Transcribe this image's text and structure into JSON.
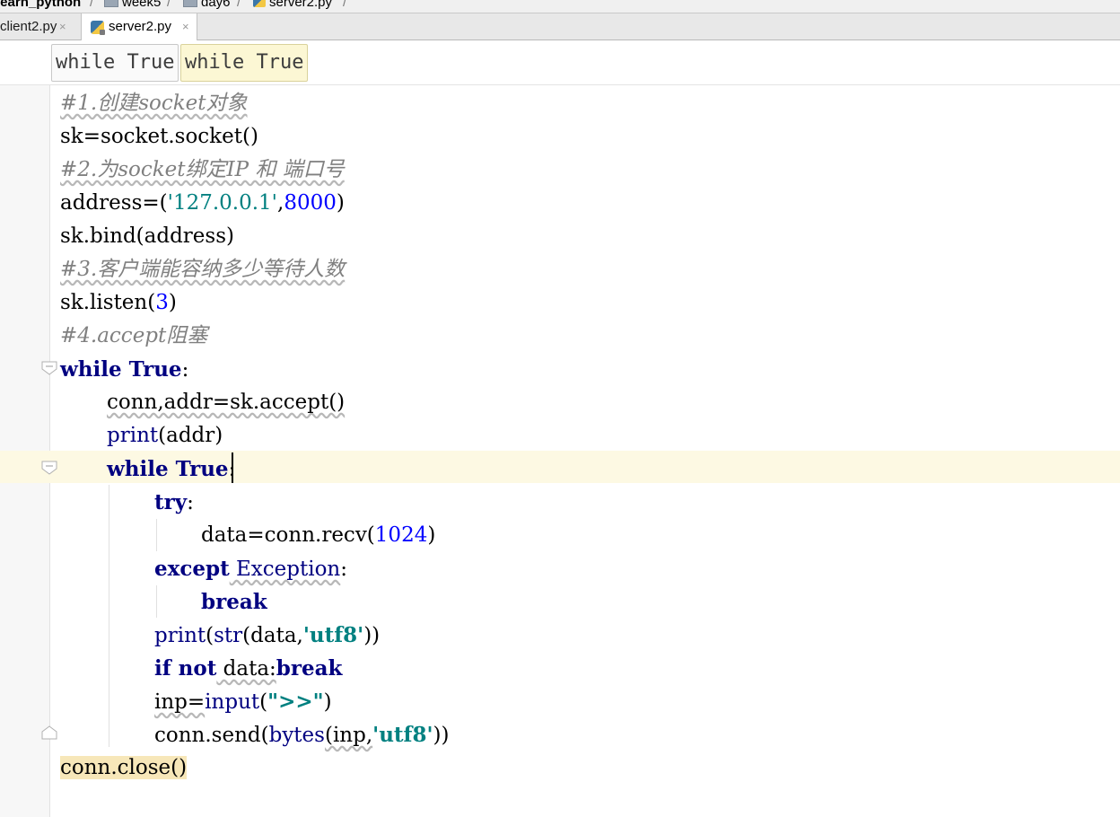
{
  "breadcrumb": {
    "project": "learn_python",
    "folder1": "week5",
    "folder2": "day6",
    "file": "server2.py"
  },
  "tabs": [
    {
      "label": "client2.py",
      "close": "×"
    },
    {
      "label": "server2.py",
      "close": "×"
    }
  ],
  "scope_chips": [
    "while True",
    "while True"
  ],
  "code": {
    "l1": "#1.创建socket对象",
    "l2": "sk=socket.socket()",
    "l3": "#2.为socket绑定IP 和 端口号",
    "l4a": "address=(",
    "l4b": "'127.0.0.1'",
    "l4c": ",",
    "l4d": "8000",
    "l4e": ")",
    "l5": "sk.bind(address)",
    "l6": "#3.客户端能容纳多少等待人数",
    "l7a": "sk.listen(",
    "l7b": "3",
    "l7c": ")",
    "l8": "#4.accept阻塞",
    "l9a": "while True",
    "l9b": ":",
    "l10": "conn,addr=sk.accept()",
    "l11a": "print",
    "l11b": "(addr)",
    "l12a": "while True",
    "l12b": ":",
    "l13a": "try",
    "l13b": ":",
    "l14a": "data=conn.recv(",
    "l14b": "1024",
    "l14c": ")",
    "l15a": "except",
    "l15b": " Exception",
    "l15c": ":",
    "l16": "break",
    "l17a": "print",
    "l17b": "(",
    "l17c": "str",
    "l17d": "(data,",
    "l17e": "'utf8'",
    "l17f": "))",
    "l18a": "if not",
    "l18b": " data:",
    "l18c": "break",
    "l19a": "inp=",
    "l19b": "input",
    "l19c": "(",
    "l19d": "\">>\"",
    "l19e": ")",
    "l20a": "conn.send(",
    "l20b": "bytes",
    "l20c": "(inp,",
    "l20d": "'utf8'",
    "l20e": "))",
    "l21": "conn.close()"
  },
  "colors": {
    "keyword": "#000080",
    "string": "#008080",
    "number": "#0000ff",
    "comment": "#808080",
    "caret_line": "#fdf9e3"
  },
  "icons": [
    "folder-icon",
    "python-file-icon",
    "close-icon",
    "fold-marker-icon"
  ]
}
